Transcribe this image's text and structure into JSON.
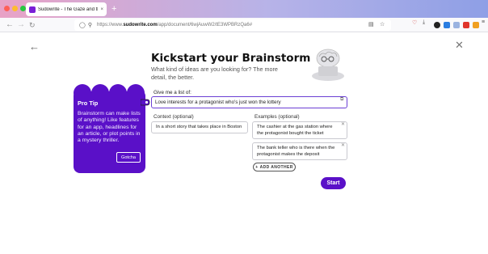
{
  "browser": {
    "tab_title": "Sudowrite - The Gaze and the",
    "tab_close": "×",
    "new_tab": "+",
    "url_prefix": "https://www.",
    "url_domain": "sudowrite.com",
    "url_path": "/app/document/6wjAuwW2/tE3WPBRzQa6#",
    "colors": {
      "tab_gradient_start": "#e8a2c6",
      "tab_gradient_end": "#8e9fe6"
    }
  },
  "page": {
    "heading": "Kickstart your Brainstorm",
    "subtitle": "What kind of ideas are you looking for? The more detail, the better.",
    "give_label": "Give me a list of:",
    "give_value": "Love interests for a protagonist who's just won the lottery",
    "context_label": "Context (optional)",
    "context_value": "In a short story that takes place in Boston",
    "examples_label": "Examples (optional)",
    "examples": [
      "The cashier at the gas station where the protagonist bought the ticket",
      "The bank teller who is there when the protagonist makes the deposit"
    ],
    "add_another": "ADD ANOTHER",
    "start": "Start",
    "accent_color": "#5a10c8"
  },
  "tip": {
    "title": "Pro Tip",
    "body": "Brainstorm can make lists of anything! Like features for an app, headlines for an article, or plot points in a mystery thriller.",
    "button": "Gotcha"
  }
}
